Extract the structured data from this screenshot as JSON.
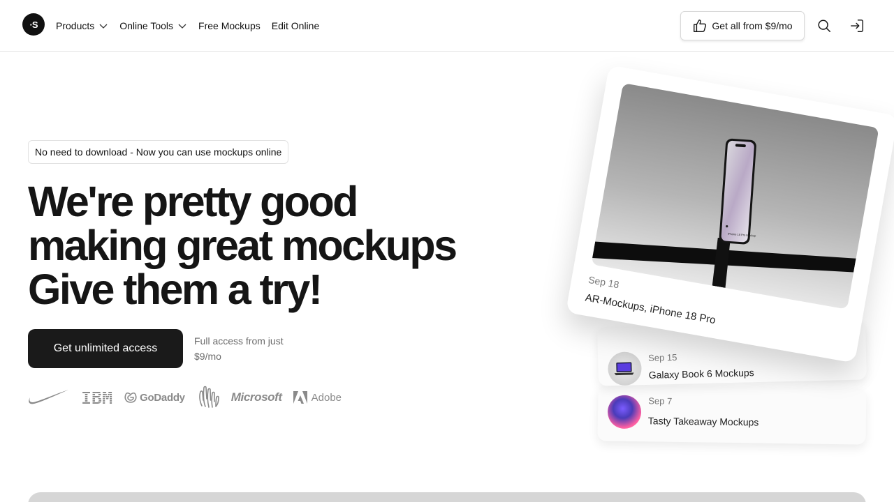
{
  "header": {
    "logo_text": "·S",
    "nav": [
      {
        "label": "Products",
        "dropdown": true
      },
      {
        "label": "Online Tools",
        "dropdown": true
      },
      {
        "label": "Free Mockups",
        "dropdown": false
      },
      {
        "label": "Edit Online",
        "dropdown": false
      }
    ],
    "cta_label": "Get all from $9/mo",
    "icons": [
      "thumbs-up-icon",
      "search-icon",
      "sign-in-icon",
      "chevron-down-icon"
    ]
  },
  "hero": {
    "pill": "No need to download - Now you can use mockups online",
    "headline": [
      "We're pretty good",
      "making great mockups",
      "Give them a try!"
    ],
    "cta_label": "Get unlimited access",
    "cta_note": "Full access from just $9/mo"
  },
  "brands": {
    "ibm": "IBM",
    "godaddy": "GoDaddy",
    "microsoft": "Microsoft",
    "adobe": "Adobe",
    "icons": [
      "nike-swoosh-icon",
      "godaddy-icon",
      "hands-icon",
      "adobe-icon"
    ]
  },
  "cards": {
    "featured": {
      "date": "Sep 18",
      "title": "AR-Mockups, iPhone 18 Pro",
      "device_text": "iPhone 18 Pro Mockup"
    },
    "items": [
      {
        "date": "Sep 15",
        "title": "Galaxy Book 6 Mockups"
      },
      {
        "date": "Sep 7",
        "title": "Tasty Takeaway Mockups"
      }
    ]
  },
  "colors": {
    "primary_button": "#1a1a1a",
    "text": "#151515",
    "muted": "#6b6b6b",
    "border": "#e2e2e2"
  }
}
